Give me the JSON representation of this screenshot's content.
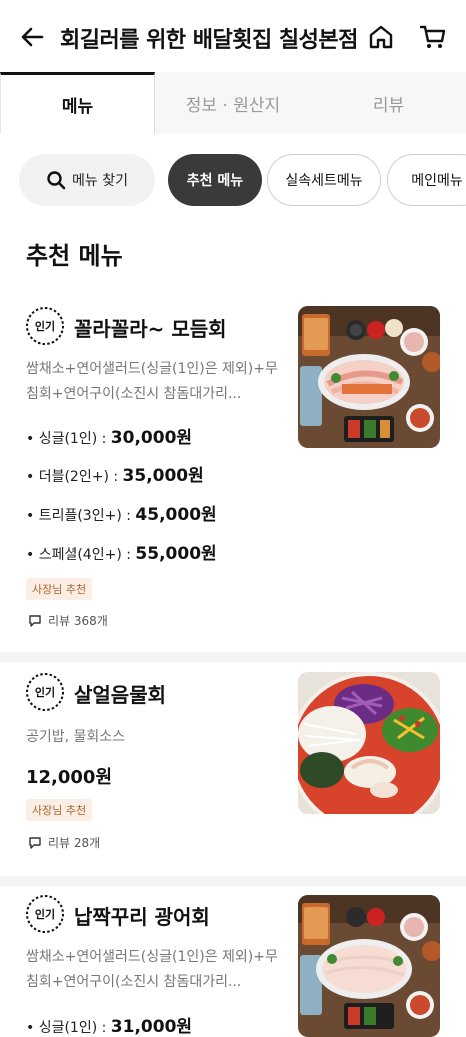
{
  "header": {
    "title": "회길러를 위한 배달횟집 칠성본점",
    "icons": {
      "back": "back-arrow-icon",
      "home": "home-icon",
      "cart": "cart-icon"
    }
  },
  "tabs": [
    {
      "label": "메뉴",
      "active": true
    },
    {
      "label": "정보 · 원산지",
      "active": false
    },
    {
      "label": "리뷰",
      "active": false
    }
  ],
  "chips": {
    "search_label": "메뉴 찾기",
    "items": [
      "추천 메뉴",
      "실속세트메뉴",
      "메인메뉴"
    ]
  },
  "section_title": "추천 메뉴",
  "badge_label": "인기",
  "owner_badge": "사장님 추천",
  "items": [
    {
      "name": "꼴라꼴라~ 모듬회",
      "desc": "쌈채소+연어샐러드(싱글(1인)은 제외)+무침회+연어구이(소진시 참돔대가리...",
      "prices": [
        {
          "label": "• 싱글(1인) : ",
          "price": "30,000원"
        },
        {
          "label": "• 더블(2인+) : ",
          "price": "35,000원"
        },
        {
          "label": "• 트리플(3인+) : ",
          "price": "45,000원"
        },
        {
          "label": "• 스페셜(4인+) : ",
          "price": "55,000원"
        }
      ],
      "review": "리뷰 368개"
    },
    {
      "name": "살얼음물회",
      "desc": "공기밥, 물회소스",
      "price": "12,000원",
      "review": "리뷰 28개"
    },
    {
      "name": "납짝꾸리 광어회",
      "desc": "쌈채소+연어샐러드(싱글(1인)은 제외)+무침회+연어구이(소진시 참돔대가리...",
      "prices": [
        {
          "label": "• 싱글(1인) : ",
          "price": "31,000원"
        }
      ]
    }
  ],
  "colors": {
    "active_chip": "#3a3a3a",
    "owner_badge_bg": "#fbeee4",
    "owner_badge_text": "#b0622d",
    "soup_red": "#d8432c"
  }
}
